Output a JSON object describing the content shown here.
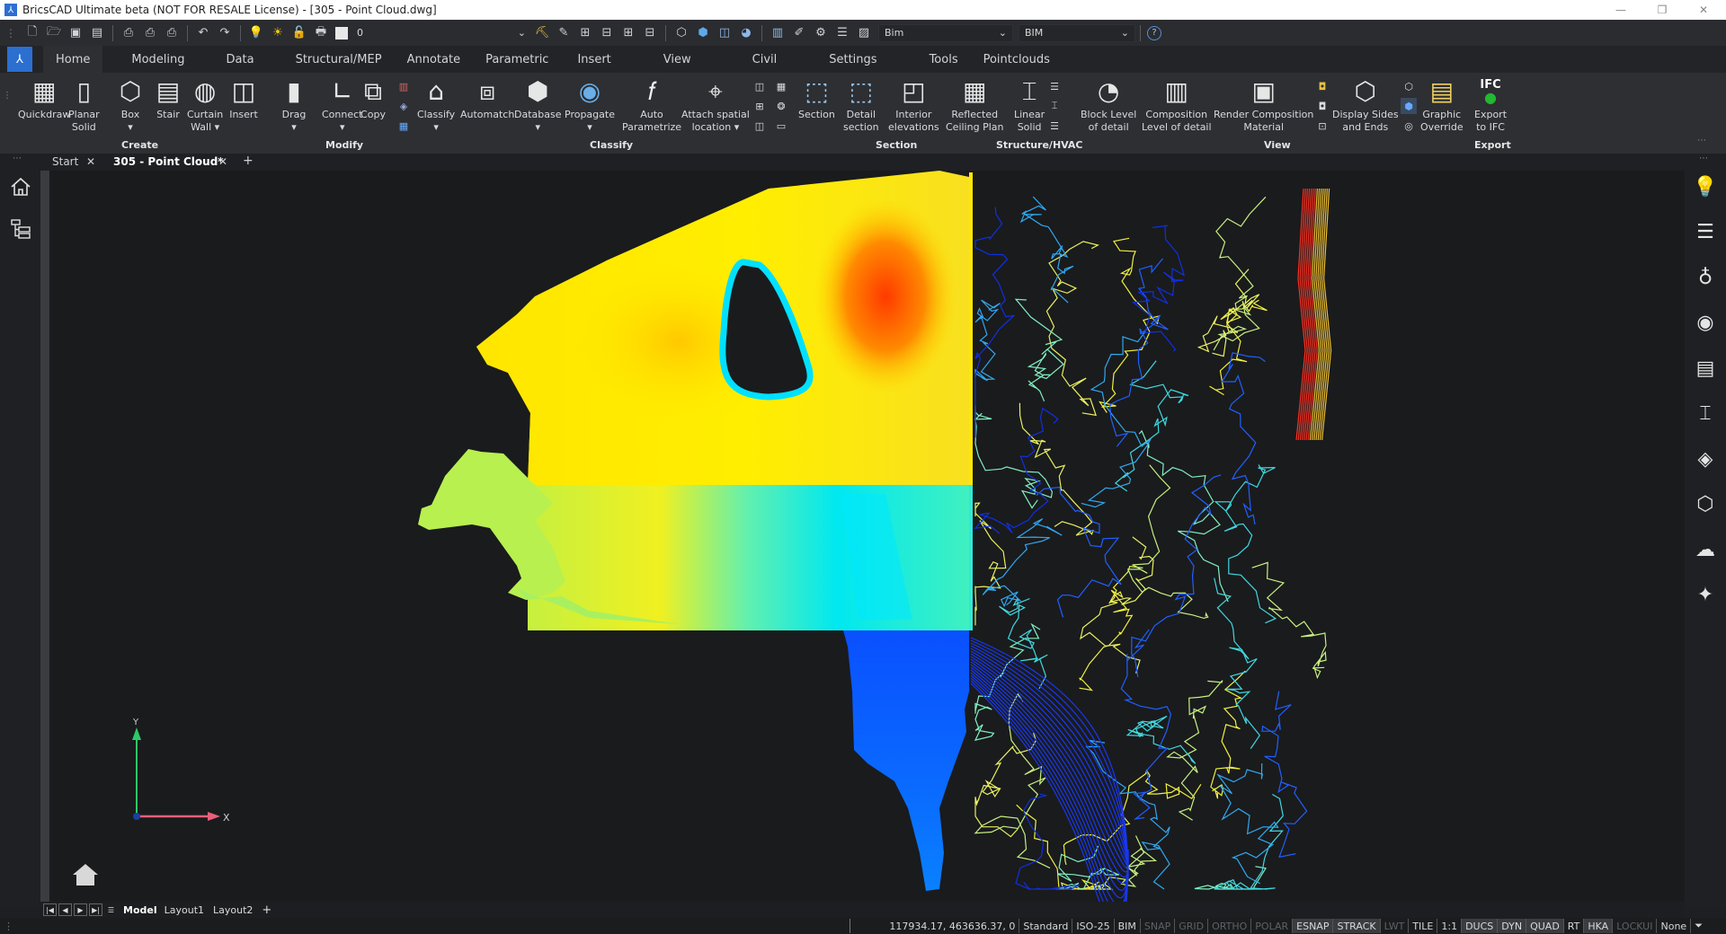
{
  "window": {
    "title": "BricsCAD Ultimate beta (NOT FOR RESALE License) - [305 - Point Cloud.dwg]",
    "controls": {
      "minimize": "—",
      "restore": "❐",
      "close": "✕"
    }
  },
  "quick_access": {
    "layer_value": "0",
    "workspace_combo": "Bim",
    "profile_combo": "BIM",
    "help_label": "?"
  },
  "menu": {
    "app_icon": "bricscad-logo-icon",
    "tabs": [
      "Home",
      "Modeling",
      "Data",
      "Structural/MEP",
      "Annotate",
      "Parametric",
      "Insert",
      "View",
      "Civil",
      "Settings",
      "Tools",
      "Pointclouds"
    ],
    "active_tab": "Home"
  },
  "ribbon": {
    "buttons": [
      {
        "label": "Quickdraw",
        "icon": "quickdraw-icon"
      },
      {
        "label": "Planar\nSolid",
        "icon": "planar-solid-icon"
      },
      {
        "label": "Box\n▾",
        "icon": "box-icon"
      },
      {
        "label": "Stair",
        "icon": "stair-icon"
      },
      {
        "label": "Curtain\nWall ▾",
        "icon": "curtain-wall-icon"
      },
      {
        "label": "Insert",
        "icon": "insert-icon"
      },
      {
        "label": "Drag\n▾",
        "icon": "drag-icon"
      },
      {
        "label": "Connect\n▾",
        "icon": "connect-icon"
      },
      {
        "label": "Copy",
        "icon": "copy-icon"
      },
      {
        "label": "Classify\n▾",
        "icon": "classify-icon"
      },
      {
        "label": "Automatch",
        "icon": "automatch-icon"
      },
      {
        "label": "Database\n▾",
        "icon": "database-icon"
      },
      {
        "label": "Propagate\n▾",
        "icon": "propagate-icon"
      },
      {
        "label": "Auto\nParametrize",
        "icon": "auto-parametrize-icon"
      },
      {
        "label": "Attach spatial\nlocation ▾",
        "icon": "attach-spatial-location-icon"
      },
      {
        "label": "Section",
        "icon": "section-icon"
      },
      {
        "label": "Detail\nsection",
        "icon": "detail-section-icon"
      },
      {
        "label": "Interior\nelevations",
        "icon": "interior-elevations-icon"
      },
      {
        "label": "Reflected\nCeiling Plan",
        "icon": "reflected-ceiling-plan-icon"
      },
      {
        "label": "Linear\nSolid",
        "icon": "linear-solid-icon"
      },
      {
        "label": "Block Level\nof detail",
        "icon": "block-level-of-detail-icon"
      },
      {
        "label": "Composition\nLevel of detail",
        "icon": "composition-level-of-detail-icon"
      },
      {
        "label": "Render Composition\nMaterial",
        "icon": "render-composition-material-icon"
      },
      {
        "label": "Display Sides\nand Ends",
        "icon": "display-sides-ends-icon"
      },
      {
        "label": "Graphic\nOverride",
        "icon": "graphic-override-icon"
      },
      {
        "label": "Export\nto IFC",
        "icon": "export-ifc-icon",
        "badge": "IFC"
      }
    ],
    "groups": [
      "Create",
      "Modify",
      "Classify",
      "Section",
      "Structure/HVAC",
      "View",
      "Export"
    ]
  },
  "document_tabs": {
    "tabs": [
      {
        "label": "Start",
        "close": "✕"
      },
      {
        "label": "305 - Point Cloud*",
        "close": "✕",
        "active": true
      }
    ],
    "add": "+"
  },
  "right_panel_icons": [
    "lightbulb-icon",
    "sliders-icon",
    "hot-air-balloon-icon",
    "sound-icon",
    "layers-table-icon",
    "i-beam-icon",
    "layers-stack-icon",
    "component-icon",
    "cloud-upload-icon",
    "pin-icon"
  ],
  "left_panel_icons": [
    "home-icon",
    "structure-tree-icon"
  ],
  "viewport": {
    "ucs": {
      "x_label": "X",
      "y_label": "Y"
    },
    "heatmap_colors": [
      "#ff3a00",
      "#ff9a00",
      "#ffee00",
      "#c8f040",
      "#00f0f0",
      "#0a5aff"
    ]
  },
  "layout_tabs": {
    "tabs": [
      "Model",
      "Layout1",
      "Layout2"
    ],
    "active": "Model",
    "add": "+"
  },
  "status_bar": {
    "coordinates": "117934.17, 463636.37, 0",
    "items": [
      {
        "label": "Standard",
        "state": "normal"
      },
      {
        "label": "ISO-25",
        "state": "normal"
      },
      {
        "label": "BIM",
        "state": "normal"
      },
      {
        "label": "SNAP",
        "state": "off"
      },
      {
        "label": "GRID",
        "state": "off"
      },
      {
        "label": "ORTHO",
        "state": "off"
      },
      {
        "label": "POLAR",
        "state": "off"
      },
      {
        "label": "ESNAP",
        "state": "on"
      },
      {
        "label": "STRACK",
        "state": "on"
      },
      {
        "label": "LWT",
        "state": "off"
      },
      {
        "label": "TILE",
        "state": "normal"
      },
      {
        "label": "1:1",
        "state": "normal"
      },
      {
        "label": "DUCS",
        "state": "on"
      },
      {
        "label": "DYN",
        "state": "on"
      },
      {
        "label": "QUAD",
        "state": "on"
      },
      {
        "label": "RT",
        "state": "normal"
      },
      {
        "label": "HKA",
        "state": "on"
      },
      {
        "label": "LOCKUI",
        "state": "off"
      },
      {
        "label": "None",
        "state": "normal"
      }
    ]
  }
}
